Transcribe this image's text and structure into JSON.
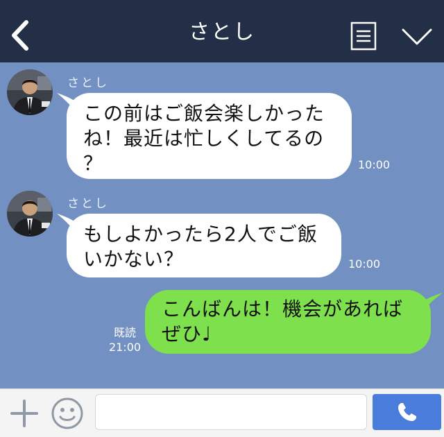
{
  "header": {
    "title": "さとし",
    "back_icon": "chevron-left-icon",
    "menu_icon": "menu-icon",
    "expand_icon": "chevron-down-icon",
    "background": "#232e47"
  },
  "chat": {
    "background": "#7290c1",
    "messages": [
      {
        "direction": "incoming",
        "sender": "さとし",
        "text": "この前はご飯会楽しかった\nね！最近は忙しくしてるの\n？",
        "time": "10:00"
      },
      {
        "direction": "incoming",
        "sender": "さとし",
        "text": "もしよかったら2人でご飯\nいかない？",
        "time": "10:00"
      },
      {
        "direction": "outgoing",
        "text": "こんばんは！機会があれば\nぜひ♩",
        "read_status": "既読",
        "time": "21:00",
        "bubble_color": "#7ee04c"
      }
    ]
  },
  "input_bar": {
    "message_value": "",
    "plus_icon": "plus-icon",
    "emoji_icon": "smile-icon",
    "send_icon": "phone-icon",
    "send_color": "#4a7ddb"
  }
}
